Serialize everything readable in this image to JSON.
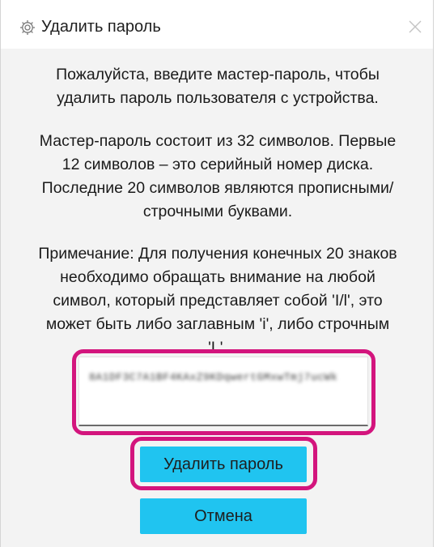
{
  "titlebar": {
    "title": "Удалить пароль",
    "icon": "gear-icon",
    "close_icon": "close-icon"
  },
  "messages": {
    "intro": [
      "Пожалуйста, введите мастер-пароль, чтобы",
      "удалить пароль пользователя с устройства."
    ],
    "details": [
      "Мастер-пароль состоит из 32 символов. Первые",
      "12 символов – это серийный номер диска.",
      "Последние 20 символов являются прописными/",
      "строчными буквами."
    ],
    "note": [
      "Примечание: Для получения конечных 20 знаков",
      "необходимо обращать внимание на любой",
      "символ, который представляет собой 'I/l', это",
      "может быть либо заглавным 'i', либо строчным",
      "'L'."
    ]
  },
  "password_field": {
    "value": "8A1DF3C7A1BF4KAxZ9KDqwertGMxwTmj7ucWk"
  },
  "buttons": {
    "delete_label": "Удалить пароль",
    "cancel_label": "Отмена"
  },
  "colors": {
    "accent": "#20c4f0",
    "highlight": "#d3157d",
    "dialog_bg": "#f3f3f3"
  }
}
